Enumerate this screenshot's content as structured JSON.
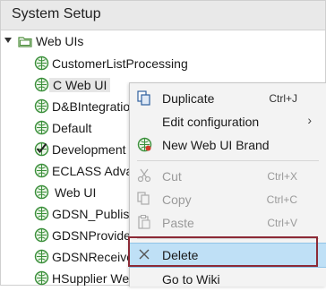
{
  "header": {
    "title": "System Setup"
  },
  "tree": {
    "root_label": "Web UIs",
    "items": [
      {
        "label": "CustomerListProcessing"
      },
      {
        "label": "C Web UI"
      },
      {
        "label": "D&BIntegratio"
      },
      {
        "label": "Default"
      },
      {
        "label": "Development"
      },
      {
        "label": "ECLASS Adva"
      },
      {
        "label": "Web UI"
      },
      {
        "label": "GDSN_Publish"
      },
      {
        "label": "GDSNProvide"
      },
      {
        "label": "GDSNReceive"
      },
      {
        "label": "HSupplier We"
      }
    ]
  },
  "context_menu": {
    "items": [
      {
        "label": "Duplicate",
        "shortcut": "Ctrl+J"
      },
      {
        "label": "Edit configuration",
        "shortcut": ""
      },
      {
        "label": "New Web UI Brand",
        "shortcut": ""
      },
      {
        "label": "Cut",
        "shortcut": "Ctrl+X"
      },
      {
        "label": "Copy",
        "shortcut": "Ctrl+C"
      },
      {
        "label": "Paste",
        "shortcut": "Ctrl+V"
      },
      {
        "label": "Delete",
        "shortcut": ""
      },
      {
        "label": "Go to Wiki",
        "shortcut": ""
      }
    ]
  },
  "colors": {
    "highlight": "#bfe0f6",
    "annotation_border": "#8c2a36",
    "icon_green": "#3a8f3a"
  }
}
